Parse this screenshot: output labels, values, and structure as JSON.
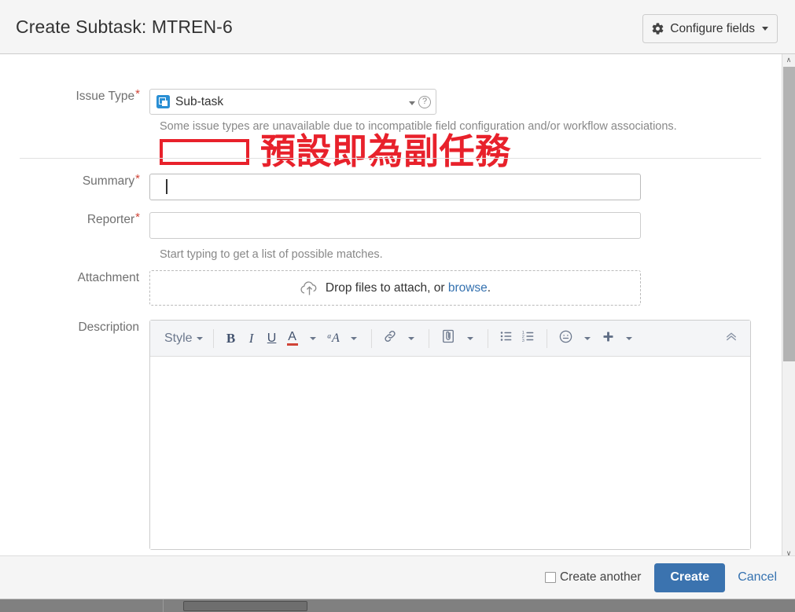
{
  "header": {
    "title": "Create Subtask: MTREN-6",
    "configure_fields_label": "Configure fields",
    "gear_icon": "gear-icon",
    "caret_icon": "chevron-down-icon"
  },
  "form": {
    "issue_type": {
      "label": "Issue Type",
      "required_marker": "*",
      "selected_value": "Sub-task",
      "icon": "sub-task-icon",
      "help_text": "Some issue types are unavailable due to incompatible field configuration and/or workflow associations.",
      "help_circle_glyph": "?"
    },
    "summary": {
      "label": "Summary",
      "required_marker": "*",
      "value": "",
      "placeholder": ""
    },
    "reporter": {
      "label": "Reporter",
      "required_marker": "*",
      "value": "",
      "placeholder": "",
      "help_text": "Start typing to get a list of possible matches."
    },
    "attachment": {
      "label": "Attachment",
      "drop_text": "Drop files to attach, or",
      "browse_label": "browse",
      "trailing_period": ".",
      "icon": "cloud-upload-icon"
    },
    "description": {
      "label": "Description",
      "value": "",
      "toolbar": {
        "style_label": "Style",
        "bold_label": "B",
        "italic_label": "I",
        "underline_label": "U",
        "text_color_label": "A",
        "text_effects_label": "ᵃA",
        "link_icon": "link-icon",
        "attach_icon": "paperclip-icon",
        "bullet_list_icon": "bullet-list-icon",
        "numbered_list_icon": "numbered-list-icon",
        "emoji_icon": "emoji-icon",
        "insert_icon": "plus-icon",
        "collapse_icon": "chevron-double-up-icon"
      }
    }
  },
  "annotation": {
    "text": "預設即為副任務",
    "color": "#e8212b"
  },
  "footer": {
    "create_another_label": "Create another",
    "create_another_checked": false,
    "create_label": "Create",
    "cancel_label": "Cancel"
  },
  "colors": {
    "accent_blue": "#3b73af",
    "link_blue": "#3572b0",
    "annotation_red": "#e8212b",
    "required_red": "#d04437",
    "subtask_blue": "#2a8fd4"
  },
  "scrollbars": {
    "vertical_up_glyph": "∧",
    "vertical_down_glyph": "∨"
  }
}
